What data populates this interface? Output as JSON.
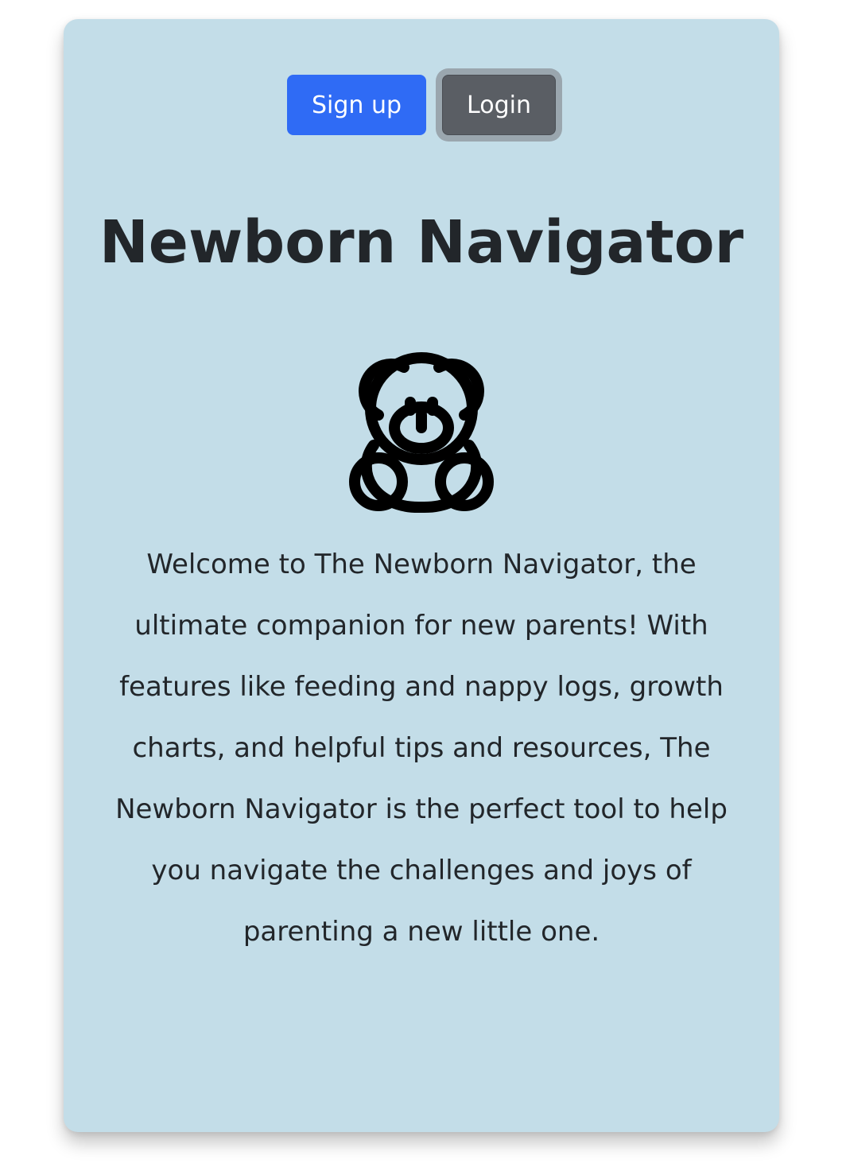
{
  "auth": {
    "signup_label": "Sign up",
    "login_label": "Login"
  },
  "main": {
    "title": "Newborn Navigator",
    "icon": "teddy-bear-icon",
    "description": "Welcome to The Newborn Navigator, the ultimate companion for new parents! With features like feeding and nappy logs, growth charts, and helpful tips and resources, The Newborn Navigator is the perfect tool to help you navigate the challenges and joys of parenting a new little one."
  },
  "colors": {
    "card_background": "#c3dde8",
    "signup_button": "#2f6bf5",
    "login_button": "#5a5e64",
    "text": "#22262a"
  }
}
